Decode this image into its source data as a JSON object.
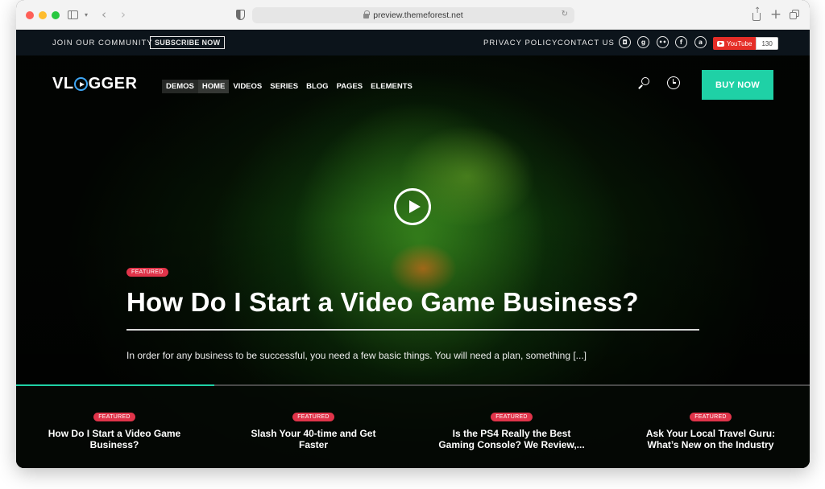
{
  "browser": {
    "url": "preview.themeforest.net"
  },
  "topbar": {
    "join": "JOIN OUR COMMUNITY",
    "subscribe": "SUBSCRIBE NOW",
    "privacy": "PRIVACY POLICY",
    "contact": "CONTACT US",
    "social": [
      {
        "icon": "instagram-icon",
        "glyph": "◘"
      },
      {
        "icon": "google-plus-icon",
        "glyph": "g"
      },
      {
        "icon": "flickr-icon",
        "glyph": "••"
      },
      {
        "icon": "facebook-icon",
        "glyph": "f"
      },
      {
        "icon": "amazon-icon",
        "glyph": "a"
      }
    ],
    "youtube": {
      "label": "YouTube",
      "count": "130"
    }
  },
  "header": {
    "logo": {
      "pre": "VL",
      "post": "GGER"
    },
    "nav": [
      "DEMOS",
      "HOME",
      "VIDEOS",
      "SERIES",
      "BLOG",
      "PAGES",
      "ELEMENTS"
    ],
    "buy": "BUY NOW"
  },
  "hero": {
    "badge": "FEATURED",
    "title": "How Do I Start a Video Game Business?",
    "excerpt": "In order for any business to be successful, you need a few basic things. You will need a plan, something [...]",
    "progress": 0.25
  },
  "slides": [
    {
      "badge": "FEATURED",
      "title_line1": "How Do I Start a Video Game",
      "title_line2": "Business?"
    },
    {
      "badge": "FEATURED",
      "title_line1": "Slash Your 40-time and Get",
      "title_line2": "Faster"
    },
    {
      "badge": "FEATURED",
      "title_line1": "Is the PS4 Really the Best",
      "title_line2": "Gaming Console? We Review,..."
    },
    {
      "badge": "FEATURED",
      "title_line1": "Ask Your Local Travel Guru:",
      "title_line2": "What’s New on the Industry"
    }
  ],
  "colors": {
    "accent": "#1fd1a6",
    "badge": "#e0344a",
    "logo_ring": "#3fa7f5",
    "topbar": "#0c141b"
  }
}
